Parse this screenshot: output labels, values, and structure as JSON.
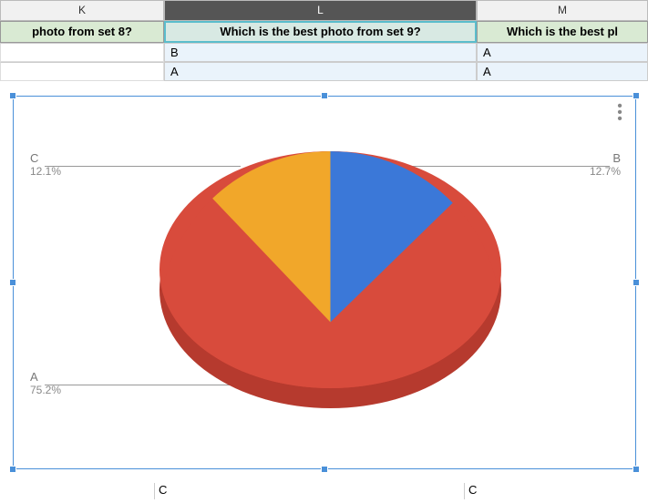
{
  "columns": {
    "k": "K",
    "l": "L",
    "m": "M"
  },
  "headers": {
    "k": "photo from set 8?",
    "l": "Which is the best photo from set 9?",
    "m": "Which is the best pl"
  },
  "rows": [
    {
      "l": "B",
      "m": "A"
    },
    {
      "l": "A",
      "m": "A"
    }
  ],
  "chart_data": {
    "type": "pie",
    "title": "",
    "series": [
      {
        "name": "A",
        "value": 75.2,
        "color": "#d84b3c"
      },
      {
        "name": "B",
        "value": 12.7,
        "color": "#3b78d8"
      },
      {
        "name": "C",
        "value": 12.1,
        "color": "#f1a72a"
      }
    ],
    "labels": {
      "A": "75.2%",
      "B": "12.7%",
      "C": "12.1%"
    }
  },
  "footer": {
    "l_left": "C",
    "l_right": "C"
  }
}
